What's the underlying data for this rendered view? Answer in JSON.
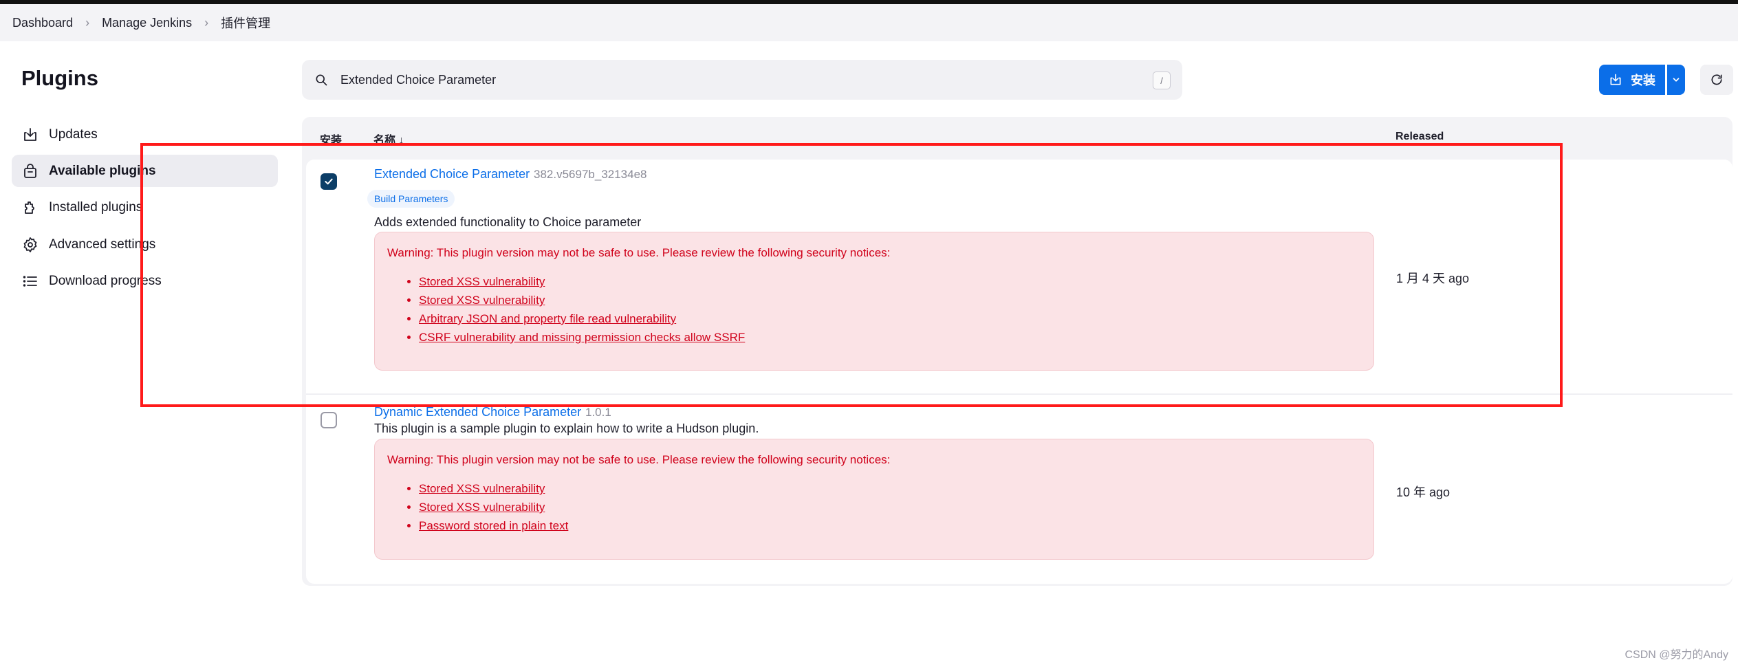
{
  "breadcrumb": [
    "Dashboard",
    "Manage Jenkins",
    "插件管理"
  ],
  "page_title": "Plugins",
  "sidebar": {
    "items": [
      {
        "label": "Updates",
        "icon": "download-icon",
        "active": false
      },
      {
        "label": "Available plugins",
        "icon": "shopping-bag-icon",
        "active": true
      },
      {
        "label": "Installed plugins",
        "icon": "puzzle-icon",
        "active": false
      },
      {
        "label": "Advanced settings",
        "icon": "gear-icon",
        "active": false
      },
      {
        "label": "Download progress",
        "icon": "list-icon",
        "active": false
      }
    ]
  },
  "search": {
    "value": "Extended Choice Parameter",
    "shortcut": "/"
  },
  "toolbar": {
    "install_label": "安装",
    "accent": "#0b6ee8"
  },
  "table": {
    "headers": {
      "install": "安装",
      "name": "名称 ↓",
      "released": "Released"
    },
    "rows": [
      {
        "checked": true,
        "name": "Extended Choice Parameter",
        "version": "382.v5697b_32134e8",
        "tag": "Build Parameters",
        "description": "Adds extended functionality to Choice parameter",
        "warning_title": "Warning: This plugin version may not be safe to use. Please review the following security notices:",
        "warnings": [
          "Stored XSS vulnerability",
          "Stored XSS vulnerability",
          "Arbitrary JSON and property file read vulnerability",
          "CSRF vulnerability and missing permission checks allow SSRF"
        ],
        "released": "1 月 4 天 ago"
      },
      {
        "checked": false,
        "name": "Dynamic Extended Choice Parameter",
        "version": "1.0.1",
        "description": "This plugin is a sample plugin to explain how to write a Hudson plugin.",
        "warning_title": "Warning: This plugin version may not be safe to use. Please review the following security notices:",
        "warnings": [
          "Stored XSS vulnerability",
          "Stored XSS vulnerability",
          "Password stored in plain text"
        ],
        "released": "10 年 ago"
      }
    ]
  },
  "watermark": "CSDN @努力的Andy",
  "colors": {
    "warning_text": "#d0021b",
    "warning_bg": "#fbe3e6",
    "highlight": "#ff1a1a"
  }
}
